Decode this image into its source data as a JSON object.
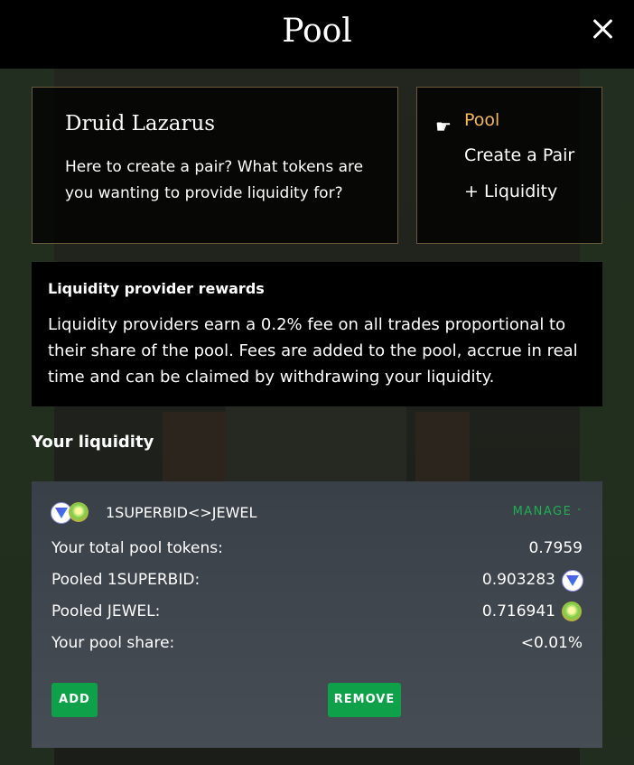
{
  "header": {
    "title": "Pool"
  },
  "npc": {
    "name": "Druid Lazarus",
    "message": "Here to create a pair? What tokens are you wanting to provide liquidity for?"
  },
  "menu": {
    "items": [
      {
        "label": "Pool",
        "active": true
      },
      {
        "label": "Create a Pair",
        "active": false
      },
      {
        "label": "+ Liquidity",
        "active": false
      }
    ]
  },
  "rewards": {
    "title": "Liquidity provider rewards",
    "text": "Liquidity providers earn a 0.2% fee on all trades proportional to their share of the pool. Fees are added to the pool, accrue in real time and can be claimed by withdrawing your liquidity."
  },
  "your_liquidity": {
    "heading": "Your liquidity",
    "pair": "1SUPERBID<>JEWEL",
    "manage_label": "MANAGE",
    "rows": [
      {
        "label": "Your total pool tokens:",
        "value": "0.7959"
      },
      {
        "label": "Pooled 1SUPERBID:",
        "value": "0.903283"
      },
      {
        "label": "Pooled JEWEL:",
        "value": "0.716941"
      },
      {
        "label": "Your pool share:",
        "value": "<0.01%"
      }
    ],
    "add_label": "ADD",
    "remove_label": "REMOVE"
  },
  "colors": {
    "accent_green": "#0fa14a",
    "menu_active": "#f4b85a",
    "manage_green": "#1fae53"
  },
  "icons": {
    "close": "close-icon",
    "pointer": "pointing-hand-icon",
    "token_superbid": "superbid-token-icon",
    "token_jewel": "jewel-token-icon"
  }
}
